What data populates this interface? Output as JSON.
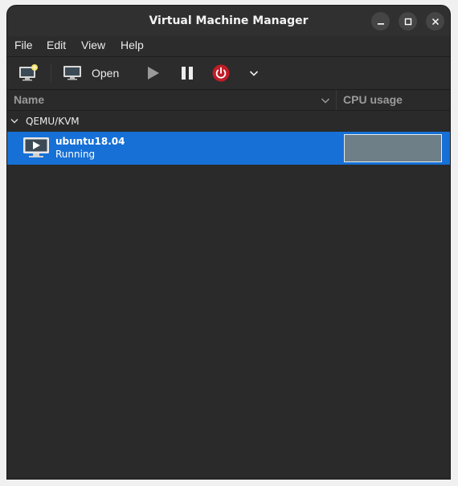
{
  "window": {
    "title": "Virtual Machine Manager"
  },
  "menu": [
    "File",
    "Edit",
    "View",
    "Help"
  ],
  "toolbar": {
    "open_label": "Open"
  },
  "columns": {
    "name": "Name",
    "cpu": "CPU usage"
  },
  "connection": {
    "name": "QEMU/KVM"
  },
  "vms": [
    {
      "name": "ubuntu18.04",
      "status": "Running",
      "cpu_usage_fraction": 0.0
    }
  ],
  "colors": {
    "selection": "#1670d6",
    "power": "#c01c28",
    "background": "#2a2a2a"
  },
  "icons": {
    "new_vm": "new-vm-icon",
    "open": "monitor-icon",
    "run": "play-icon",
    "pause": "pause-icon",
    "shutdown": "power-icon",
    "shutdown_menu": "chevron-down-icon",
    "vm": "vm-display-icon"
  }
}
